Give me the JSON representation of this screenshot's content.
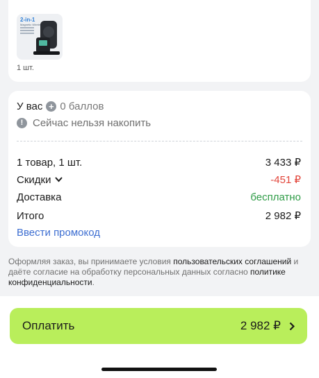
{
  "product": {
    "thumb_title": "2-in-1",
    "thumb_subtitle": "Magnetic Wireless Charger",
    "quantity": "1 шт."
  },
  "summary": {
    "points_label": "У вас",
    "points_value": "0 баллов",
    "info_text": "Сейчас нельзя накопить",
    "goods_label": "1 товар, 1 шт.",
    "goods_value": "3 433 ₽",
    "discount_label": "Скидки",
    "discount_value": "-451 ₽",
    "delivery_label": "Доставка",
    "delivery_value": "бесплатно",
    "total_label": "Итого",
    "total_value": "2 982 ₽",
    "promo_label": "Ввести промокод"
  },
  "terms": {
    "part1": "Оформляя заказ, вы принимаете условия ",
    "link1": "пользовательских соглашений",
    "part2": " и даёте согласие на обработку персональных данных согласно ",
    "link2": "политике конфиденциальности",
    "part3": "."
  },
  "pay_button": {
    "label": "Оплатить",
    "amount": "2 982 ₽"
  },
  "colors": {
    "pay_button": "#b9ee5b",
    "discount": "#e2463b",
    "free_delivery": "#2f9c47",
    "link": "#3d6ed1"
  }
}
